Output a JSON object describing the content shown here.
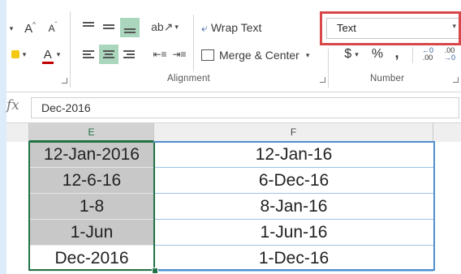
{
  "ribbon": {
    "font_grow": "A",
    "font_shrink": "A",
    "font_color": "A",
    "wrap_text": "Wrap Text",
    "merge_center": "Merge & Center",
    "alignment_label": "Alignment",
    "number_label": "Number",
    "number_format_value": "Text",
    "currency_symbol": "$",
    "percent_symbol": "%",
    "comma_symbol": ",",
    "increase_decimal": ".00",
    "decrease_decimal": ".00"
  },
  "formula_bar": {
    "fx": "fx",
    "value": "Dec-2016"
  },
  "sheet": {
    "columns": [
      "E",
      "F"
    ],
    "col_e": [
      "12-Jan-2016",
      "12-6-16",
      "1-8",
      "1-Jun",
      "Dec-2016"
    ],
    "col_f": [
      "12-Jan-16",
      "6-Dec-16",
      "8-Jan-16",
      "1-Jun-16",
      "1-Dec-16"
    ]
  },
  "colors": {
    "ribbon_bg": "#ffffff",
    "highlight_border": "#d9474a",
    "selection_green": "#217346",
    "selection_blue": "#4f8fd0"
  }
}
